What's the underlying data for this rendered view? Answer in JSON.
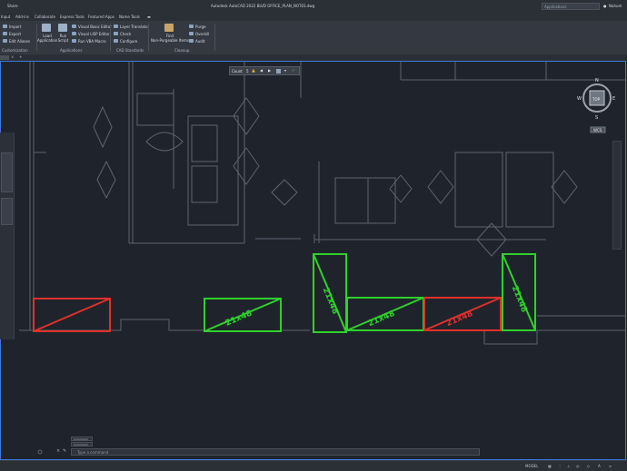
{
  "title_bar": {
    "menu_left": "Share",
    "app_title": "Autodesk AutoCAD 2022   BLVD OFFICE_PLAN_NOTES.dwg",
    "search_placeholder": "Applications",
    "user_label": "Nahum"
  },
  "ribbon_tabs": [
    "Input",
    "Add-ins",
    "Collaborate",
    "Express Tools",
    "Featured Apps",
    "Name Tools"
  ],
  "ribbon": {
    "import_label": "Import",
    "export_label": "Export",
    "edit_aliases_label": "Edit Aliases",
    "load_application_label": "Load Application",
    "run_script_label": "Run Script",
    "visual_basic_editor_label": "Visual Basic Editor",
    "visual_lisp_editor_label": "Visual LISP Editor",
    "run_vba_macro_label": "Run VBA Macro",
    "layer_translator_label": "Layer Translator",
    "check_label": "Check",
    "configure_label": "Configure",
    "find_label": "Find",
    "non_purgeable_items_label": "Non-Purgeable Items",
    "purge_label": "Purge",
    "overkill_label": "Overkill",
    "audit_label": "Audit",
    "panel_customization": "Customization",
    "panel_applications": "Applications",
    "panel_cad_standards": "CAD Standards",
    "panel_cleanup": "Cleanup"
  },
  "floating_toolbar": {
    "label": "Count",
    "count_value": "5"
  },
  "viewcube": {
    "north": "N",
    "south": "S",
    "east": "E",
    "west": "W",
    "face": "TOP",
    "wcs": "WCS"
  },
  "plan_labels": [
    "21x48",
    "21x48",
    "21x48",
    "21x48",
    "21x48"
  ],
  "command": {
    "history_1": "Command:",
    "history_2": "Command:",
    "placeholder": "Type a command"
  },
  "status": {
    "model_label": "MODEL"
  },
  "colors": {
    "match_green": "#2fd12a",
    "mismatch_red": "#e0312a",
    "highlight_blue": "#3f78d8",
    "linework": "#5d6470"
  }
}
